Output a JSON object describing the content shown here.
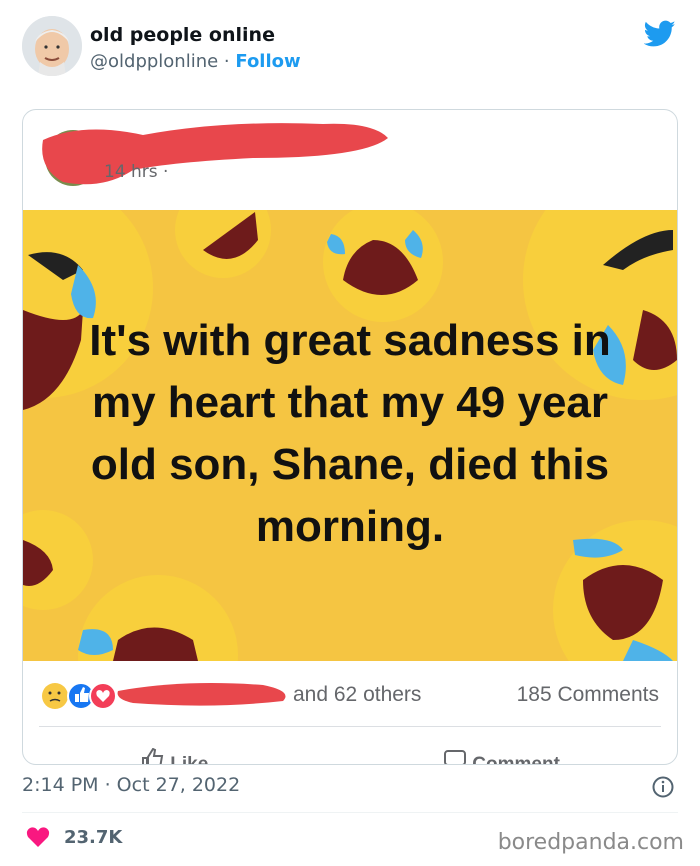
{
  "tweet": {
    "display_name": "old people online",
    "handle": "@oldpplonline",
    "separator": " · ",
    "follow_label": "Follow",
    "timestamp": "2:14 PM · Oct 27, 2022",
    "likes": "23.7K"
  },
  "post": {
    "time": "14 hrs ·",
    "image_text": "It's with great sadness in my heart that my 49 year old son, Shane, died this morning.",
    "reactions_text": "and 62 others",
    "comments_text": "185 Comments",
    "like_label": "Like",
    "comment_label": "Comment"
  },
  "watermark": "boredpanda.com",
  "colors": {
    "accent": "#1d9bf0",
    "like_heart": "#f91880",
    "image_bg": "#f5c542",
    "redaction": "#e8474c"
  }
}
